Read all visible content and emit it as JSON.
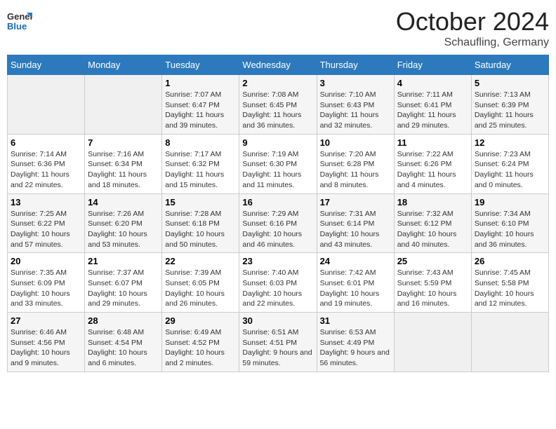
{
  "header": {
    "logo_general": "General",
    "logo_blue": "Blue",
    "month_title": "October 2024",
    "location": "Schaufling, Germany"
  },
  "days_of_week": [
    "Sunday",
    "Monday",
    "Tuesday",
    "Wednesday",
    "Thursday",
    "Friday",
    "Saturday"
  ],
  "weeks": [
    [
      {
        "day": "",
        "info": ""
      },
      {
        "day": "",
        "info": ""
      },
      {
        "day": "1",
        "info": "Sunrise: 7:07 AM\nSunset: 6:47 PM\nDaylight: 11 hours and 39 minutes."
      },
      {
        "day": "2",
        "info": "Sunrise: 7:08 AM\nSunset: 6:45 PM\nDaylight: 11 hours and 36 minutes."
      },
      {
        "day": "3",
        "info": "Sunrise: 7:10 AM\nSunset: 6:43 PM\nDaylight: 11 hours and 32 minutes."
      },
      {
        "day": "4",
        "info": "Sunrise: 7:11 AM\nSunset: 6:41 PM\nDaylight: 11 hours and 29 minutes."
      },
      {
        "day": "5",
        "info": "Sunrise: 7:13 AM\nSunset: 6:39 PM\nDaylight: 11 hours and 25 minutes."
      }
    ],
    [
      {
        "day": "6",
        "info": "Sunrise: 7:14 AM\nSunset: 6:36 PM\nDaylight: 11 hours and 22 minutes."
      },
      {
        "day": "7",
        "info": "Sunrise: 7:16 AM\nSunset: 6:34 PM\nDaylight: 11 hours and 18 minutes."
      },
      {
        "day": "8",
        "info": "Sunrise: 7:17 AM\nSunset: 6:32 PM\nDaylight: 11 hours and 15 minutes."
      },
      {
        "day": "9",
        "info": "Sunrise: 7:19 AM\nSunset: 6:30 PM\nDaylight: 11 hours and 11 minutes."
      },
      {
        "day": "10",
        "info": "Sunrise: 7:20 AM\nSunset: 6:28 PM\nDaylight: 11 hours and 8 minutes."
      },
      {
        "day": "11",
        "info": "Sunrise: 7:22 AM\nSunset: 6:26 PM\nDaylight: 11 hours and 4 minutes."
      },
      {
        "day": "12",
        "info": "Sunrise: 7:23 AM\nSunset: 6:24 PM\nDaylight: 11 hours and 0 minutes."
      }
    ],
    [
      {
        "day": "13",
        "info": "Sunrise: 7:25 AM\nSunset: 6:22 PM\nDaylight: 10 hours and 57 minutes."
      },
      {
        "day": "14",
        "info": "Sunrise: 7:26 AM\nSunset: 6:20 PM\nDaylight: 10 hours and 53 minutes."
      },
      {
        "day": "15",
        "info": "Sunrise: 7:28 AM\nSunset: 6:18 PM\nDaylight: 10 hours and 50 minutes."
      },
      {
        "day": "16",
        "info": "Sunrise: 7:29 AM\nSunset: 6:16 PM\nDaylight: 10 hours and 46 minutes."
      },
      {
        "day": "17",
        "info": "Sunrise: 7:31 AM\nSunset: 6:14 PM\nDaylight: 10 hours and 43 minutes."
      },
      {
        "day": "18",
        "info": "Sunrise: 7:32 AM\nSunset: 6:12 PM\nDaylight: 10 hours and 40 minutes."
      },
      {
        "day": "19",
        "info": "Sunrise: 7:34 AM\nSunset: 6:10 PM\nDaylight: 10 hours and 36 minutes."
      }
    ],
    [
      {
        "day": "20",
        "info": "Sunrise: 7:35 AM\nSunset: 6:09 PM\nDaylight: 10 hours and 33 minutes."
      },
      {
        "day": "21",
        "info": "Sunrise: 7:37 AM\nSunset: 6:07 PM\nDaylight: 10 hours and 29 minutes."
      },
      {
        "day": "22",
        "info": "Sunrise: 7:39 AM\nSunset: 6:05 PM\nDaylight: 10 hours and 26 minutes."
      },
      {
        "day": "23",
        "info": "Sunrise: 7:40 AM\nSunset: 6:03 PM\nDaylight: 10 hours and 22 minutes."
      },
      {
        "day": "24",
        "info": "Sunrise: 7:42 AM\nSunset: 6:01 PM\nDaylight: 10 hours and 19 minutes."
      },
      {
        "day": "25",
        "info": "Sunrise: 7:43 AM\nSunset: 5:59 PM\nDaylight: 10 hours and 16 minutes."
      },
      {
        "day": "26",
        "info": "Sunrise: 7:45 AM\nSunset: 5:58 PM\nDaylight: 10 hours and 12 minutes."
      }
    ],
    [
      {
        "day": "27",
        "info": "Sunrise: 6:46 AM\nSunset: 4:56 PM\nDaylight: 10 hours and 9 minutes."
      },
      {
        "day": "28",
        "info": "Sunrise: 6:48 AM\nSunset: 4:54 PM\nDaylight: 10 hours and 6 minutes."
      },
      {
        "day": "29",
        "info": "Sunrise: 6:49 AM\nSunset: 4:52 PM\nDaylight: 10 hours and 2 minutes."
      },
      {
        "day": "30",
        "info": "Sunrise: 6:51 AM\nSunset: 4:51 PM\nDaylight: 9 hours and 59 minutes."
      },
      {
        "day": "31",
        "info": "Sunrise: 6:53 AM\nSunset: 4:49 PM\nDaylight: 9 hours and 56 minutes."
      },
      {
        "day": "",
        "info": ""
      },
      {
        "day": "",
        "info": ""
      }
    ]
  ]
}
